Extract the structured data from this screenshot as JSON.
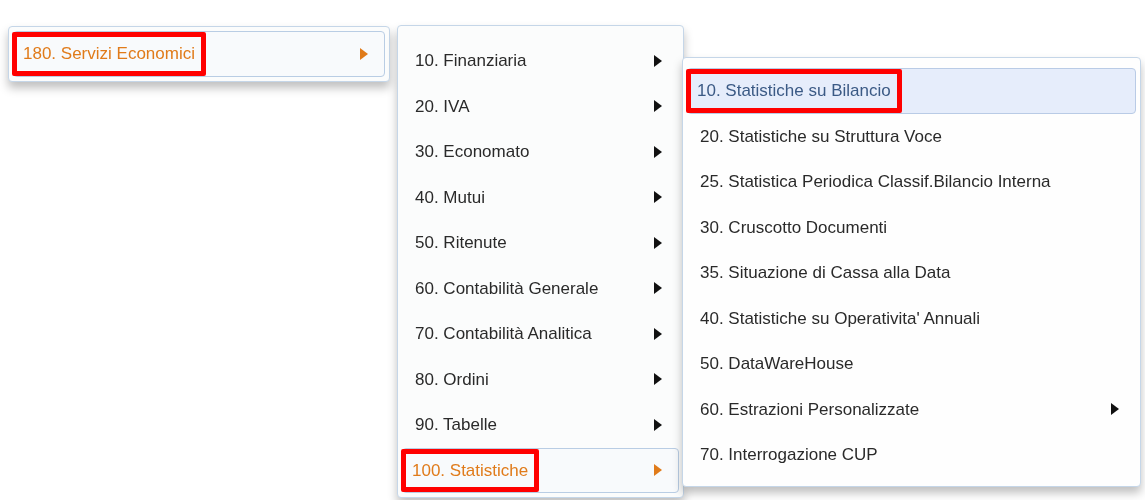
{
  "menus": [
    {
      "items": [
        {
          "label": "180. Servizi Economici",
          "submenu": true,
          "selected": true,
          "marked": true
        }
      ]
    },
    {
      "items": [
        {
          "label": "10. Finanziaria",
          "submenu": true,
          "selected": false,
          "marked": false
        },
        {
          "label": "20. IVA",
          "submenu": true,
          "selected": false,
          "marked": false
        },
        {
          "label": "30. Economato",
          "submenu": true,
          "selected": false,
          "marked": false
        },
        {
          "label": "40. Mutui",
          "submenu": true,
          "selected": false,
          "marked": false
        },
        {
          "label": "50. Ritenute",
          "submenu": true,
          "selected": false,
          "marked": false
        },
        {
          "label": "60. Contabilità Generale",
          "submenu": true,
          "selected": false,
          "marked": false
        },
        {
          "label": "70. Contabilità Analitica",
          "submenu": true,
          "selected": false,
          "marked": false
        },
        {
          "label": "80. Ordini",
          "submenu": true,
          "selected": false,
          "marked": false
        },
        {
          "label": "90. Tabelle",
          "submenu": true,
          "selected": false,
          "marked": false
        },
        {
          "label": "100. Statistiche",
          "submenu": true,
          "selected": true,
          "marked": true
        }
      ]
    },
    {
      "items": [
        {
          "label": "10. Statistiche su Bilancio",
          "submenu": false,
          "selected": true,
          "marked": true
        },
        {
          "label": "20. Statistiche su Struttura Voce",
          "submenu": false,
          "selected": false,
          "marked": false
        },
        {
          "label": "25. Statistica Periodica Classif.Bilancio Interna",
          "submenu": false,
          "selected": false,
          "marked": false
        },
        {
          "label": "30. Cruscotto Documenti",
          "submenu": false,
          "selected": false,
          "marked": false
        },
        {
          "label": "35. Situazione di Cassa alla Data",
          "submenu": false,
          "selected": false,
          "marked": false
        },
        {
          "label": "40. Statistiche su Operativita' Annuali",
          "submenu": false,
          "selected": false,
          "marked": false
        },
        {
          "label": "50. DataWareHouse",
          "submenu": false,
          "selected": false,
          "marked": false
        },
        {
          "label": "60. Estrazioni Personalizzate",
          "submenu": true,
          "selected": false,
          "marked": false
        },
        {
          "label": "70. Interrogazione CUP",
          "submenu": false,
          "selected": false,
          "marked": false
        }
      ]
    }
  ]
}
